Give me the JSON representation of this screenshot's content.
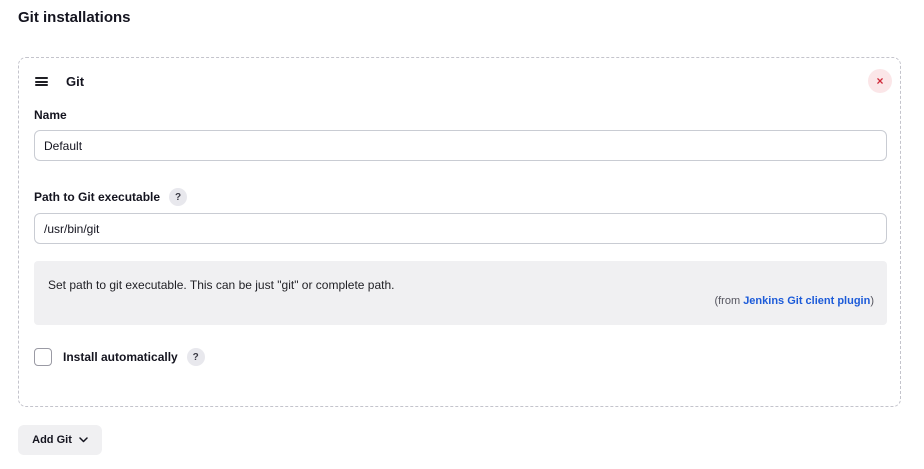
{
  "section": {
    "title": "Git installations"
  },
  "installation": {
    "title": "Git",
    "delete_label": "×",
    "name": {
      "label": "Name",
      "value": "Default"
    },
    "path": {
      "label": "Path to Git executable",
      "help_label": "?",
      "value": "/usr/bin/git",
      "help_text": "Set path to git executable. This can be just \"git\" or complete path.",
      "help_source_prefix": "(from ",
      "help_source_link": "Jenkins Git client plugin",
      "help_source_suffix": ")"
    },
    "install_auto": {
      "label": "Install automatically",
      "help_label": "?",
      "checked": false
    }
  },
  "add_button": {
    "label": "Add Git"
  },
  "colors": {
    "link": "#1c5bd9",
    "delete": "#d02a3a",
    "delete_bg": "#fbe6e8",
    "panel_bg": "#f0f0f2"
  },
  "icons": {
    "drag": "drag-handle-icon",
    "delete": "close-icon",
    "help": "help-icon",
    "dropdown": "chevron-down-icon"
  }
}
